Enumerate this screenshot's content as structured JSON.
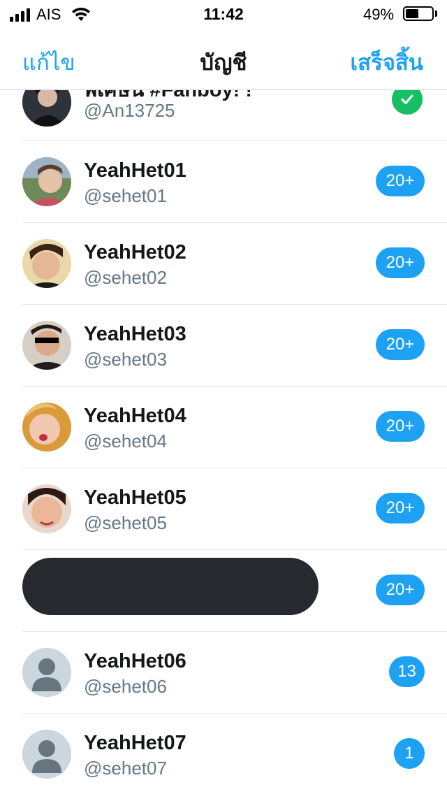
{
  "status_bar": {
    "carrier": "AIS",
    "time": "11:42",
    "battery_percent_text": "49%",
    "battery_level": 0.49
  },
  "nav": {
    "left": "แก้ไข",
    "title": "บัญชี",
    "right": "เสร็จสิ้น"
  },
  "accounts": [
    {
      "name": "พิเศษน #Fanboy! !",
      "handle": "@An13725",
      "status": "selected",
      "icon": "check-icon"
    },
    {
      "name": "YeahHet01",
      "handle": "@sehet01",
      "badge": "20+"
    },
    {
      "name": "YeahHet02",
      "handle": "@sehet02",
      "badge": "20+"
    },
    {
      "name": "YeahHet03",
      "handle": "@sehet03",
      "badge": "20+"
    },
    {
      "name": "YeahHet04",
      "handle": "@sehet04",
      "badge": "20+"
    },
    {
      "name": "YeahHet05",
      "handle": "@sehet05",
      "badge": "20+"
    },
    {
      "redacted": true,
      "badge": "20+"
    },
    {
      "name": "YeahHet06",
      "handle": "@sehet06",
      "badge": "13",
      "avatar": "default-avatar"
    },
    {
      "name": "YeahHet07",
      "handle": "@sehet07",
      "badge": "1",
      "avatar": "default-avatar"
    }
  ],
  "colors": {
    "accent": "#1da1f2",
    "selected_check": "#17bf63",
    "name_text": "#14171a",
    "handle_text": "#657786",
    "divider": "#e1e8ed"
  }
}
